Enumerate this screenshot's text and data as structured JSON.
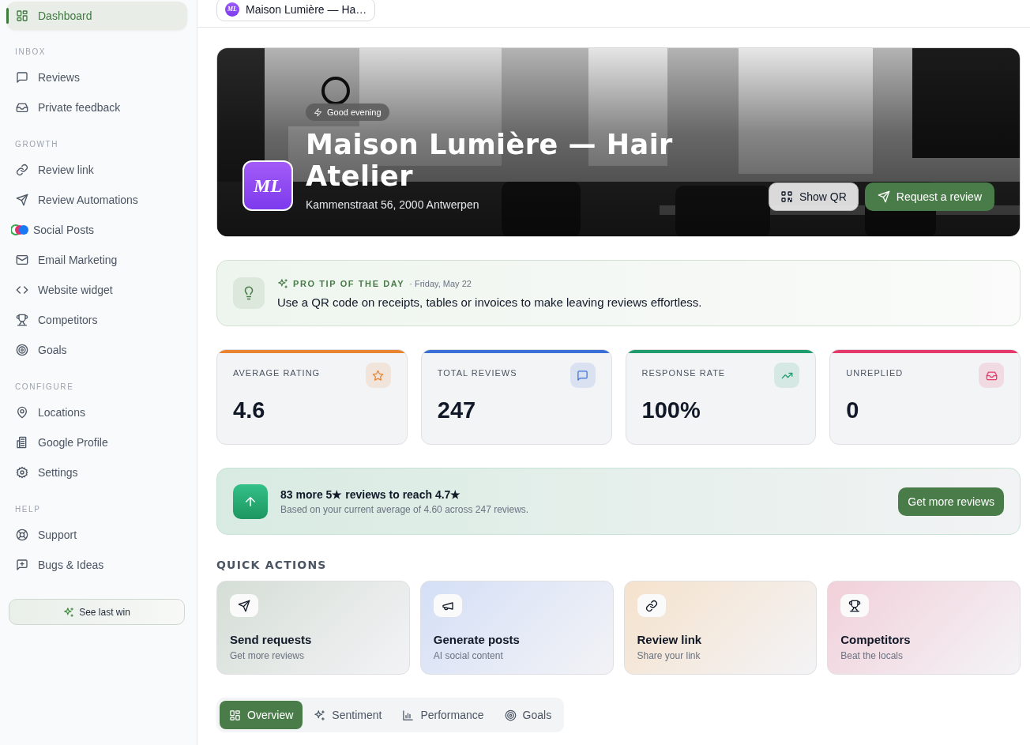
{
  "topbar": {
    "location_logo": "ML",
    "location": "Maison Lumière — Ha…"
  },
  "sidebar": {
    "home": {
      "label": "Dashboard",
      "selected": true
    },
    "sections": [
      {
        "heading": "INBOX",
        "items": [
          {
            "label": "Reviews",
            "selected": false
          },
          {
            "label": "Private feedback",
            "selected": false
          }
        ]
      },
      {
        "heading": "GROWTH",
        "items": [
          {
            "label": "Review link",
            "selected": false
          },
          {
            "label": "Review Automations",
            "selected": false
          },
          {
            "label": "Social Posts",
            "selected": false
          },
          {
            "label": "Email Marketing",
            "selected": false
          },
          {
            "label": "Website widget",
            "selected": false
          },
          {
            "label": "Competitors",
            "selected": false
          },
          {
            "label": "Goals",
            "selected": false
          }
        ]
      },
      {
        "heading": "CONFIGURE",
        "items": [
          {
            "label": "Locations",
            "selected": false
          },
          {
            "label": "Google Profile",
            "selected": false
          },
          {
            "label": "Settings",
            "selected": false
          }
        ]
      },
      {
        "heading": "HELP",
        "items": [
          {
            "label": "Support",
            "selected": false
          },
          {
            "label": "Bugs & Ideas",
            "selected": false
          }
        ]
      }
    ],
    "footer_button": "See last win"
  },
  "hero": {
    "picture": {
      "kind": "picture"
    },
    "greeting": "Good evening",
    "title": "Maison Lumière — Hair Atelier",
    "logo": "ML",
    "address": "Kammenstraat 56, 2000 Antwerpen",
    "buttons": [
      "Show QR",
      "Request a review"
    ]
  },
  "tip": {
    "heading": "PRO TIP OF THE DAY",
    "date": "· Friday, May 22",
    "text": "Use a QR code on receipts, tables or invoices to make leaving reviews effortless."
  },
  "stats": [
    {
      "label": "AVERAGE RATING",
      "value": "4.6",
      "color": "#e8832f"
    },
    {
      "label": "TOTAL REVIEWS",
      "value": "247",
      "color": "#3b6fd8"
    },
    {
      "label": "RESPONSE RATE",
      "value": "100%",
      "color": "#1f9b6e"
    },
    {
      "label": "UNREPLIED",
      "value": "0",
      "color": "#e5396b"
    }
  ],
  "goal_banner": {
    "title": "83 more 5★ reviews to reach 4.7★",
    "subtitle": "Based on your current average of 4.60 across 247 reviews.",
    "button": "Get more reviews"
  },
  "quick_actions": {
    "heading": "QUICK ACTIONS",
    "items": [
      {
        "title": "Send requests",
        "subtitle": "Get more reviews",
        "color": "#d5ded6"
      },
      {
        "title": "Generate posts",
        "subtitle": "AI social content",
        "color": "#d4dff6"
      },
      {
        "title": "Review link",
        "subtitle": "Share your link",
        "color": "#f5e2cc"
      },
      {
        "title": "Competitors",
        "subtitle": "Beat the locals",
        "color": "#f2d0da"
      }
    ]
  },
  "tabs": [
    {
      "label": "Overview",
      "selected": true
    },
    {
      "label": "Sentiment",
      "selected": false
    },
    {
      "label": "Performance",
      "selected": false
    },
    {
      "label": "Goals",
      "selected": false
    }
  ]
}
